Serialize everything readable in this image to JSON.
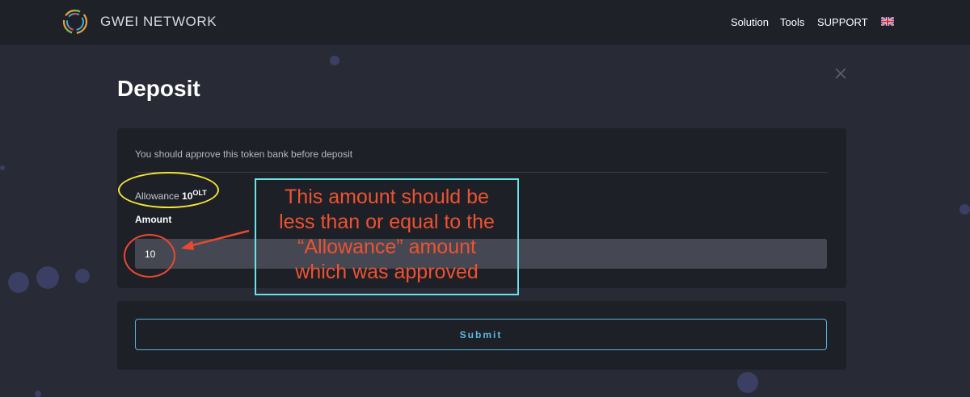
{
  "colors": {
    "background": "#282a35",
    "navbar": "#1f2129",
    "card": "#1e2028",
    "input": "#454852",
    "accent": "#57b3d9",
    "annotation_red": "#ee5231",
    "annotation_yellow": "#f2e534",
    "annotation_cyan": "#69e3e8"
  },
  "header": {
    "brand": "GWEI NETWORK",
    "logo_icon": "ring-logo-icon",
    "nav": [
      "Solution",
      "Tools",
      "SUPPORT"
    ],
    "language_icon": "uk-flag-icon"
  },
  "modal": {
    "title": "Deposit",
    "close_icon": "close-icon",
    "info": "You should approve this token bank before deposit",
    "allowance_label": "Allowance",
    "allowance_value": "10",
    "allowance_unit": "OLT",
    "amount_label": "Amount",
    "amount_value": "10",
    "submit_label": "Submit"
  },
  "annotation": {
    "lines": [
      "This amount should be",
      "less than or equal to the",
      "“Allowance” amount",
      "which was approved"
    ]
  }
}
